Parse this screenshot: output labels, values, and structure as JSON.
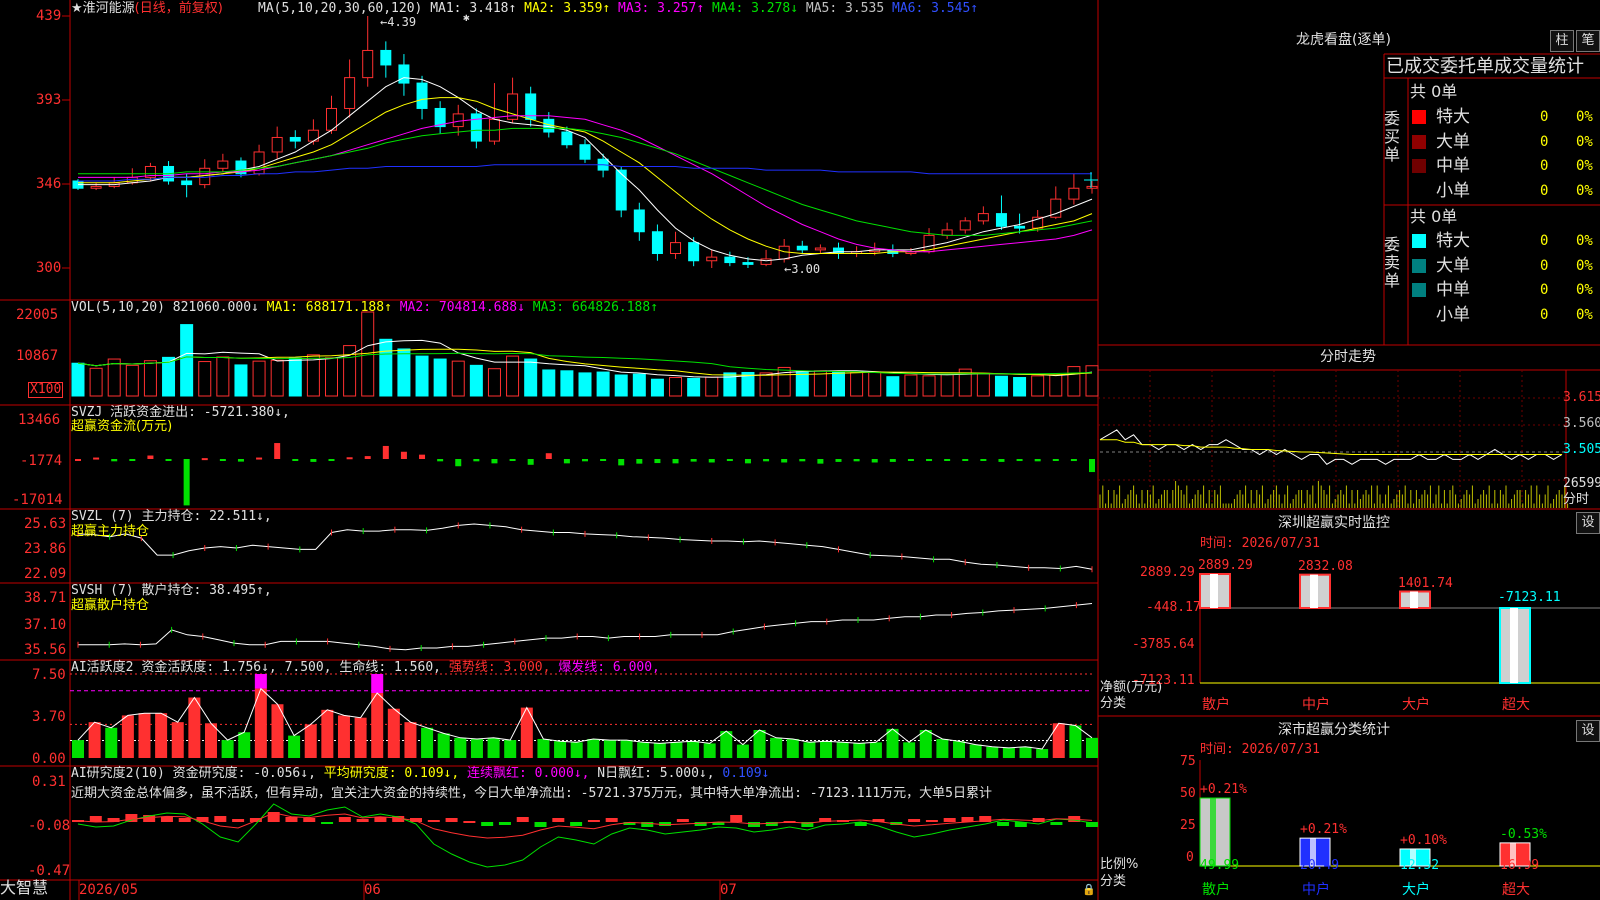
{
  "colors": {
    "up": "#ff3030",
    "down": "#00ffff",
    "ma1": "#ffffff",
    "ma2": "#ffff00",
    "ma3": "#ff00ff",
    "ma4": "#00e000",
    "ma5": "#a0a0a0",
    "ma6": "#2030ff",
    "border": "#c00000"
  },
  "kline": {
    "star": "★",
    "stock_name": "淮河能源",
    "period": "(日线，前复权)",
    "ma_param_label": "MA(5,10,20,30,60,120)",
    "ma1": "MA1: 3.418↑",
    "ma2": "MA2: 3.359↑",
    "ma3": "MA3: 3.257↑",
    "ma4": "MA4: 3.278↓",
    "ma5": "MA5: 3.535",
    "ma6": "MA6: 3.545↑",
    "y_labels": [
      "439",
      "393",
      "346",
      "300"
    ],
    "high_label": "←4.39",
    "low_label": "←3.00",
    "marker": "✱",
    "candles": [
      [
        3.48,
        3.44,
        3.49,
        3.43
      ],
      [
        3.44,
        3.45,
        3.47,
        3.43
      ],
      [
        3.45,
        3.47,
        3.5,
        3.44
      ],
      [
        3.47,
        3.5,
        3.55,
        3.46
      ],
      [
        3.5,
        3.56,
        3.58,
        3.48
      ],
      [
        3.56,
        3.48,
        3.59,
        3.46
      ],
      [
        3.48,
        3.46,
        3.52,
        3.39
      ],
      [
        3.46,
        3.55,
        3.6,
        3.44
      ],
      [
        3.55,
        3.59,
        3.63,
        3.53
      ],
      [
        3.59,
        3.52,
        3.61,
        3.5
      ],
      [
        3.52,
        3.64,
        3.68,
        3.51
      ],
      [
        3.64,
        3.72,
        3.78,
        3.6
      ],
      [
        3.72,
        3.7,
        3.76,
        3.66
      ],
      [
        3.7,
        3.76,
        3.82,
        3.68
      ],
      [
        3.76,
        3.88,
        3.95,
        3.74
      ],
      [
        3.88,
        4.05,
        4.15,
        3.83
      ],
      [
        4.05,
        4.2,
        4.39,
        4.0
      ],
      [
        4.2,
        4.12,
        4.25,
        4.05
      ],
      [
        4.12,
        4.02,
        4.18,
        3.95
      ],
      [
        4.02,
        3.88,
        4.06,
        3.82
      ],
      [
        3.88,
        3.78,
        3.92,
        3.74
      ],
      [
        3.78,
        3.85,
        3.9,
        3.73
      ],
      [
        3.85,
        3.7,
        3.88,
        3.66
      ],
      [
        3.7,
        3.82,
        4.02,
        3.68
      ],
      [
        3.82,
        3.96,
        4.05,
        3.8
      ],
      [
        3.96,
        3.82,
        4.0,
        3.78
      ],
      [
        3.82,
        3.75,
        3.86,
        3.72
      ],
      [
        3.75,
        3.68,
        3.78,
        3.66
      ],
      [
        3.68,
        3.6,
        3.71,
        3.58
      ],
      [
        3.6,
        3.54,
        3.63,
        3.5
      ],
      [
        3.54,
        3.32,
        3.56,
        3.28
      ],
      [
        3.32,
        3.2,
        3.36,
        3.15
      ],
      [
        3.2,
        3.08,
        3.24,
        3.04
      ],
      [
        3.08,
        3.14,
        3.2,
        3.05
      ],
      [
        3.14,
        3.04,
        3.17,
        3.01
      ],
      [
        3.04,
        3.06,
        3.1,
        3.0
      ],
      [
        3.06,
        3.03,
        3.09,
        3.01
      ],
      [
        3.03,
        3.02,
        3.06,
        3.0
      ],
      [
        3.02,
        3.05,
        3.1,
        3.01
      ],
      [
        3.05,
        3.12,
        3.16,
        3.03
      ],
      [
        3.12,
        3.1,
        3.15,
        3.08
      ],
      [
        3.1,
        3.11,
        3.13,
        3.08
      ],
      [
        3.11,
        3.08,
        3.14,
        3.05
      ],
      [
        3.08,
        3.09,
        3.12,
        3.06
      ],
      [
        3.09,
        3.1,
        3.14,
        3.07
      ],
      [
        3.1,
        3.08,
        3.13,
        3.06
      ],
      [
        3.08,
        3.09,
        3.11,
        3.07
      ],
      [
        3.09,
        3.18,
        3.22,
        3.08
      ],
      [
        3.18,
        3.21,
        3.25,
        3.16
      ],
      [
        3.21,
        3.26,
        3.28,
        3.19
      ],
      [
        3.26,
        3.3,
        3.34,
        3.24
      ],
      [
        3.3,
        3.23,
        3.4,
        3.21
      ],
      [
        3.23,
        3.22,
        3.3,
        3.19
      ],
      [
        3.22,
        3.28,
        3.32,
        3.2
      ],
      [
        3.28,
        3.38,
        3.45,
        3.27
      ],
      [
        3.38,
        3.44,
        3.52,
        3.35
      ],
      [
        3.44,
        3.45,
        3.48,
        3.41
      ]
    ],
    "ma_series": {
      "ma1": [
        3.46,
        3.46,
        3.46,
        3.47,
        3.48,
        3.5,
        3.5,
        3.51,
        3.52,
        3.54,
        3.56,
        3.6,
        3.64,
        3.7,
        3.76,
        3.84,
        3.92,
        4.0,
        4.05,
        4.04,
        4.0,
        3.94,
        3.87,
        3.82,
        3.8,
        3.79,
        3.78,
        3.76,
        3.72,
        3.62,
        3.52,
        3.43,
        3.32,
        3.22,
        3.15,
        3.1,
        3.07,
        3.05,
        3.04,
        3.05,
        3.07,
        3.08,
        3.09,
        3.09,
        3.1,
        3.1,
        3.1,
        3.12,
        3.14,
        3.17,
        3.2,
        3.22,
        3.24,
        3.27,
        3.3,
        3.34,
        3.38
      ],
      "ma2": [
        3.47,
        3.47,
        3.47,
        3.48,
        3.49,
        3.5,
        3.5,
        3.51,
        3.52,
        3.53,
        3.55,
        3.58,
        3.61,
        3.64,
        3.68,
        3.74,
        3.8,
        3.86,
        3.9,
        3.93,
        3.94,
        3.94,
        3.92,
        3.88,
        3.85,
        3.82,
        3.79,
        3.77,
        3.75,
        3.7,
        3.64,
        3.58,
        3.5,
        3.42,
        3.34,
        3.27,
        3.21,
        3.16,
        3.12,
        3.09,
        3.08,
        3.08,
        3.08,
        3.08,
        3.08,
        3.09,
        3.09,
        3.1,
        3.12,
        3.14,
        3.16,
        3.18,
        3.2,
        3.22,
        3.24,
        3.26,
        3.3
      ],
      "ma3": [
        3.5,
        3.5,
        3.5,
        3.5,
        3.51,
        3.51,
        3.52,
        3.52,
        3.53,
        3.53,
        3.54,
        3.56,
        3.58,
        3.6,
        3.62,
        3.65,
        3.68,
        3.71,
        3.74,
        3.77,
        3.79,
        3.81,
        3.82,
        3.83,
        3.84,
        3.84,
        3.84,
        3.83,
        3.82,
        3.79,
        3.76,
        3.72,
        3.67,
        3.62,
        3.57,
        3.52,
        3.46,
        3.4,
        3.34,
        3.29,
        3.24,
        3.2,
        3.16,
        3.13,
        3.11,
        3.1,
        3.09,
        3.09,
        3.1,
        3.11,
        3.12,
        3.13,
        3.14,
        3.15,
        3.16,
        3.18,
        3.21
      ],
      "ma4": [
        3.52,
        3.52,
        3.52,
        3.52,
        3.52,
        3.52,
        3.53,
        3.53,
        3.53,
        3.54,
        3.55,
        3.56,
        3.58,
        3.6,
        3.62,
        3.64,
        3.66,
        3.69,
        3.71,
        3.73,
        3.74,
        3.75,
        3.76,
        3.76,
        3.77,
        3.77,
        3.77,
        3.77,
        3.76,
        3.74,
        3.72,
        3.69,
        3.66,
        3.63,
        3.59,
        3.55,
        3.51,
        3.47,
        3.43,
        3.39,
        3.35,
        3.32,
        3.29,
        3.26,
        3.24,
        3.22,
        3.2,
        3.19,
        3.18,
        3.18,
        3.18,
        3.19,
        3.2,
        3.21,
        3.22,
        3.24,
        3.26
      ],
      "ma6": [
        3.48,
        3.48,
        3.48,
        3.49,
        3.49,
        3.5,
        3.5,
        3.5,
        3.51,
        3.51,
        3.52,
        3.52,
        3.53,
        3.53,
        3.54,
        3.55,
        3.55,
        3.56,
        3.56,
        3.56,
        3.56,
        3.56,
        3.56,
        3.57,
        3.57,
        3.57,
        3.57,
        3.57,
        3.57,
        3.57,
        3.56,
        3.56,
        3.56,
        3.56,
        3.55,
        3.55,
        3.55,
        3.55,
        3.54,
        3.54,
        3.54,
        3.54,
        3.53,
        3.53,
        3.53,
        3.53,
        3.53,
        3.52,
        3.52,
        3.52,
        3.52,
        3.52,
        3.52,
        3.52,
        3.52,
        3.52,
        3.52
      ]
    }
  },
  "vol": {
    "title": "VOL(5,10,20)",
    "value": "821060.000↓",
    "ma1": "MA1: 688171.188↑",
    "ma2": "MA2: 704814.688↓",
    "ma3": "MA3: 664826.188↑",
    "y_labels": [
      "22005",
      "10867"
    ],
    "unit_label": "X100",
    "values": [
      7.8,
      6.6,
      8.8,
      7.3,
      8.4,
      9.2,
      17.0,
      8.2,
      9.3,
      7.4,
      8.3,
      8.5,
      9.0,
      9.8,
      9.1,
      12.0,
      20.0,
      13.5,
      11.2,
      9.5,
      8.8,
      8.3,
      7.3,
      6.5,
      9.5,
      8.8,
      6.2,
      6.0,
      5.5,
      5.7,
      5.0,
      5.2,
      4.0,
      4.4,
      4.2,
      4.5,
      5.5,
      5.6,
      5.5,
      6.8,
      5.8,
      6.0,
      5.9,
      5.6,
      5.7,
      4.6,
      5.0,
      4.8,
      5.1,
      6.4,
      5.4,
      4.7,
      4.4,
      4.8,
      5.0,
      7.0,
      7.2
    ]
  },
  "svzj": {
    "title": "SVZJ",
    "label": "活跃资金进出: -5721.380↓,",
    "sublabel": "超赢资金流(万元)",
    "y_labels": [
      "13466",
      "-1774",
      "-17014"
    ],
    "values": [
      0,
      0.5,
      -0.8,
      -0.6,
      1.2,
      -0.5,
      -16,
      0.3,
      -0.4,
      -0.9,
      0.5,
      5.5,
      -0.5,
      -1.0,
      -0.5,
      0.6,
      1.0,
      4.5,
      2.5,
      1.5,
      -0.8,
      -2.5,
      -0.8,
      -1.5,
      -0.6,
      -2.0,
      2.0,
      -1.5,
      -0.8,
      -0.4,
      -2.2,
      -1.6,
      -1.4,
      -1.5,
      -0.9,
      -1.2,
      -0.7,
      -1.5,
      -0.8,
      -1.2,
      -0.8,
      -1.6,
      -1.0,
      -0.8,
      -1.2,
      -1.0,
      -0.5,
      -0.7,
      -0.4,
      -0.6,
      -0.3,
      -1.0,
      -0.7,
      -0.8,
      -0.5,
      -0.7,
      -4.5
    ]
  },
  "svzl": {
    "title": "SVZL (7) 主力持仓: 22.511↓,",
    "sublabel": "超赢主力持仓",
    "y_labels": [
      "25.63",
      "23.86",
      "22.09"
    ],
    "values": [
      25.0,
      24.95,
      24.8,
      25.0,
      24.7,
      23.5,
      23.5,
      23.8,
      24.0,
      24.1,
      24.0,
      24.2,
      24.1,
      24.0,
      23.9,
      23.9,
      25.1,
      25.3,
      25.2,
      25.2,
      25.3,
      25.3,
      25.25,
      25.4,
      25.6,
      25.7,
      25.6,
      25.5,
      25.3,
      25.2,
      25.1,
      25.1,
      25.0,
      24.95,
      24.9,
      24.8,
      24.75,
      24.7,
      24.6,
      24.55,
      24.5,
      24.5,
      24.45,
      24.5,
      24.4,
      24.3,
      24.2,
      24.1,
      23.9,
      23.7,
      23.5,
      23.45,
      23.4,
      23.3,
      23.2,
      23.2,
      23.0,
      22.85,
      22.8,
      22.7,
      22.6,
      22.6,
      22.55,
      22.7,
      22.5
    ]
  },
  "svsh": {
    "title": "SVSH (7) 散户持仓: 38.495↑,",
    "sublabel": "超赢散户持仓",
    "y_labels": [
      "38.71",
      "37.10",
      "35.56"
    ],
    "values": [
      36.0,
      36.0,
      36.0,
      36.05,
      36.0,
      36.05,
      36.9,
      36.6,
      36.5,
      36.3,
      36.1,
      36.0,
      36.0,
      36.2,
      36.2,
      36.2,
      36.2,
      36.1,
      36.0,
      35.9,
      35.75,
      35.7,
      35.8,
      35.8,
      35.9,
      35.9,
      36.0,
      36.1,
      36.2,
      36.3,
      36.4,
      36.4,
      36.5,
      36.5,
      36.4,
      36.5,
      36.5,
      36.5,
      36.6,
      36.6,
      36.6,
      36.6,
      36.8,
      36.95,
      37.1,
      37.2,
      37.3,
      37.4,
      37.4,
      37.5,
      37.5,
      37.5,
      37.6,
      37.7,
      37.7,
      37.8,
      37.8,
      37.9,
      37.95,
      38.05,
      38.1,
      38.15,
      38.2,
      38.3,
      38.4,
      38.5
    ]
  },
  "ai_active": {
    "title": "AI活跃度2",
    "label": "资金活跃度: 1.756↓, 7.500, 生命线: 1.560,",
    "label_trend": "强势线: 3.000,",
    "label_burst": "爆发线: 6.000,",
    "y_labels": [
      "7.50",
      "3.70",
      "0.00"
    ],
    "values": [
      1.6,
      3.2,
      2.7,
      3.8,
      4.0,
      4.0,
      3.2,
      5.4,
      3.1,
      1.6,
      2.3,
      6.2,
      4.8,
      2.0,
      3.0,
      4.3,
      3.8,
      3.6,
      5.8,
      4.4,
      3.2,
      2.7,
      2.2,
      1.8,
      1.7,
      1.8,
      1.6,
      4.5,
      1.7,
      1.5,
      1.4,
      1.7,
      1.6,
      1.6,
      1.4,
      1.3,
      1.4,
      1.5,
      1.3,
      2.4,
      1.2,
      2.5,
      1.8,
      1.7,
      1.4,
      1.5,
      1.4,
      1.3,
      1.4,
      2.6,
      1.4,
      2.5,
      1.7,
      1.5,
      1.2,
      1.0,
      0.9,
      1.0,
      0.8,
      3.1,
      2.9,
      1.8
    ],
    "hilite": [
      11,
      18
    ]
  },
  "ai_research": {
    "title": "AI研究度2(10)",
    "label": "资金研究度: -0.056↓,",
    "label_avg": "平均研究度: 0.109↓,",
    "label_red": "连续飘红: 0.000↓,",
    "label_n": "N日飘红: 5.000↓,",
    "label_last": "0.109↓",
    "y_labels": [
      "0.31",
      "-0.08",
      "-0.47"
    ],
    "commentary": "近期大资金总体偏多，虽不活跃，但有异动，宜关注大资金的持续性，今日大单净流出: -5721.375万元，其中特大单净流出: -7123.111万元，大单5日累计",
    "bars": [
      0.02,
      0.06,
      0.04,
      0.08,
      0.07,
      0.05,
      0.04,
      0.05,
      0.06,
      0.03,
      0.04,
      0.1,
      0.05,
      0.04,
      -0.02,
      0.05,
      0.03,
      0.05,
      0.06,
      0.04,
      0.02,
      0.04,
      0.01,
      -0.04,
      -0.03,
      0.05,
      -0.05,
      0.04,
      -0.04,
      0.02,
      0.04,
      -0.03,
      -0.05,
      -0.04,
      0.03,
      -0.04,
      -0.03,
      0.07,
      -0.05,
      -0.04,
      0.01,
      -0.05,
      0.04,
      0.02,
      -0.04,
      0.03,
      -0.03,
      0.03,
      0.02,
      0.04,
      0.05,
      0.06,
      -0.04,
      -0.05,
      0.04,
      -0.03,
      0.06,
      -0.05
    ],
    "line": [
      -0.02,
      -0.05,
      -0.04,
      0.02,
      0.06,
      0.09,
      0.08,
      -0.02,
      -0.15,
      -0.2,
      -0.02,
      0.18,
      0.08,
      0.06,
      0.12,
      0.15,
      0.05,
      0.08,
      0.05,
      -0.02,
      -0.22,
      -0.32,
      -0.4,
      -0.45,
      -0.43,
      -0.38,
      -0.25,
      -0.15,
      -0.18,
      -0.22,
      -0.12,
      -0.06,
      -0.08,
      -0.12,
      -0.1,
      -0.08,
      -0.05,
      -0.06,
      -0.1,
      -0.08,
      -0.05,
      -0.08,
      -0.03,
      -0.02,
      0.0,
      -0.04,
      -0.1,
      -0.15,
      -0.12,
      -0.08,
      -0.05,
      -0.02,
      0.02,
      0.0,
      -0.02,
      0.03,
      0.02,
      -0.01
    ]
  },
  "xaxis": {
    "labels": [
      "2026/05",
      "06",
      "07"
    ]
  },
  "brand": "大智慧",
  "right": {
    "lhb_title": "龙虎看盘(逐单)",
    "btn_zhu": "柱",
    "btn_bi": "笔",
    "lhb_header": "已成交委托单成交量统计",
    "buy_label": "委买单",
    "sell_label": "委卖单",
    "buy_total": "共 0单",
    "sell_total": "共 0单",
    "rows": [
      {
        "name": "特大",
        "count": "0",
        "pct": "0%"
      },
      {
        "name": "大单",
        "count": "0",
        "pct": "0%"
      },
      {
        "name": "中单",
        "count": "0",
        "pct": "0%"
      },
      {
        "name": "小单",
        "count": "0",
        "pct": "0%"
      }
    ],
    "buy_colors": [
      "#ff0000",
      "#900000",
      "#700000",
      ""
    ],
    "sell_colors": [
      "#00ffff",
      "#008080",
      "#008080",
      ""
    ],
    "fs_title": "分时走势",
    "fs_labels": [
      "3.615",
      "3.560",
      "3.505",
      "26599",
      "分时"
    ],
    "fs_price": [
      3.53,
      3.54,
      3.55,
      3.53,
      3.54,
      3.52,
      3.52,
      3.51,
      3.52,
      3.52,
      3.51,
      3.52,
      3.51,
      3.52,
      3.52,
      3.53,
      3.52,
      3.51,
      3.51,
      3.5,
      3.51,
      3.5,
      3.51,
      3.5,
      3.49,
      3.5,
      3.5,
      3.48,
      3.49,
      3.49,
      3.48,
      3.49,
      3.49,
      3.49,
      3.48,
      3.49,
      3.49,
      3.49,
      3.5,
      3.49,
      3.49,
      3.5,
      3.49,
      3.49,
      3.5,
      3.49,
      3.5,
      3.51,
      3.5,
      3.49,
      3.5,
      3.49,
      3.5,
      3.5,
      3.49,
      3.5
    ],
    "fs_avg": [
      3.53,
      3.53,
      3.53,
      3.525,
      3.525,
      3.52,
      3.52,
      3.52,
      3.52,
      3.52,
      3.518,
      3.518,
      3.515,
      3.515,
      3.515,
      3.515,
      3.513,
      3.512,
      3.51,
      3.51,
      3.51,
      3.508,
      3.507,
      3.506,
      3.505,
      3.505,
      3.504,
      3.503,
      3.502,
      3.501,
      3.5,
      3.5,
      3.5,
      3.5,
      3.5,
      3.5,
      3.5,
      3.5,
      3.5,
      3.5,
      3.5,
      3.5,
      3.5,
      3.5,
      3.5,
      3.5,
      3.5,
      3.5,
      3.5,
      3.5,
      3.5,
      3.5,
      3.5,
      3.5,
      3.5,
      3.5
    ],
    "fs_vol": [
      2,
      3,
      2,
      1,
      4,
      3,
      2,
      1,
      3,
      5,
      2,
      1,
      2,
      3,
      2,
      6,
      1,
      2,
      3,
      2,
      1,
      4,
      2,
      1,
      3,
      2,
      5,
      2,
      1,
      2,
      3,
      1,
      2,
      4,
      2,
      1,
      2,
      3,
      1,
      2,
      2,
      3,
      4,
      1,
      2,
      1,
      2,
      3,
      2,
      1,
      3,
      2,
      4,
      2,
      1,
      2
    ],
    "rt_title": "深圳超赢实时监控",
    "rt_btn": "设",
    "rt_time": "时间: 2026/07/31",
    "rt_y": [
      "2889.29",
      "-448.17",
      "-3785.64",
      "-7123.11"
    ],
    "rt_ylabel": "净额(万元)",
    "rt_xlabel": "分类",
    "rt_values": [
      {
        "name": "散户",
        "value": 2889.29,
        "label": "2889.29"
      },
      {
        "name": "中户",
        "value": 2832.08,
        "label": "2832.08"
      },
      {
        "name": "大户",
        "value": 1401.74,
        "label": "1401.74"
      },
      {
        "name": "超大",
        "value": -7123.11,
        "label": "-7123.11"
      }
    ],
    "cs_title": "深市超赢分类统计",
    "cs_btn": "设",
    "cs_time": "时间: 2026/07/31",
    "cs_y": [
      "75",
      "50",
      "25",
      "0"
    ],
    "cs_ylabel": "比例%",
    "cs_xlabel": "分类",
    "cs_values": [
      {
        "name": "散户",
        "value": 49.99,
        "label": "49.99",
        "delta": "+0.21%",
        "color": "#c8c8c8",
        "accent": "#00e000",
        "name_color": "#00e000"
      },
      {
        "name": "中户",
        "value": 20.49,
        "label": "20.49",
        "delta": "+0.21%",
        "color": "#2030ff",
        "accent": "#ffffff",
        "name_color": "#2030ff"
      },
      {
        "name": "大户",
        "value": 12.52,
        "label": "12.52",
        "delta": "+0.10%",
        "color": "#00ffff",
        "accent": "#ffffff",
        "name_color": "#00ffff"
      },
      {
        "name": "超大",
        "value": 16.99,
        "label": "16.99",
        "delta": "-0.53%",
        "color": "#ff3030",
        "accent": "#ffffff",
        "name_color": "#ff3030"
      }
    ]
  }
}
